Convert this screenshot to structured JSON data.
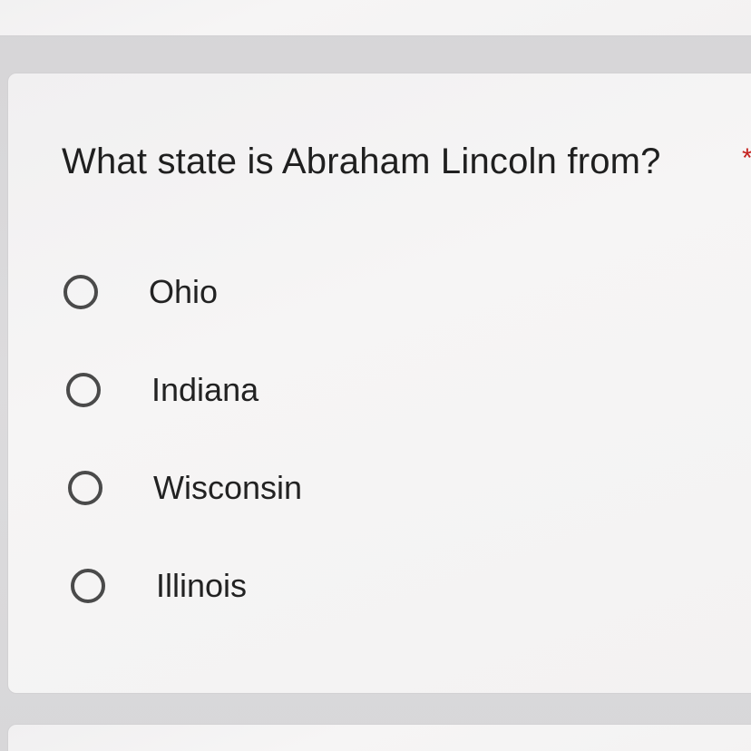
{
  "question": {
    "title": "What state is Abraham Lincoln from?",
    "required_marker": "*",
    "options": [
      {
        "label": "Ohio",
        "selected": false
      },
      {
        "label": "Indiana",
        "selected": false
      },
      {
        "label": "Wisconsin",
        "selected": false
      },
      {
        "label": "Illinois",
        "selected": false
      }
    ]
  },
  "colors": {
    "page_background": "#d9d8da",
    "card_background": "#f5f4f4",
    "text": "#1f1f1f",
    "radio_border": "#4a4a4a",
    "required": "#c5221f"
  }
}
